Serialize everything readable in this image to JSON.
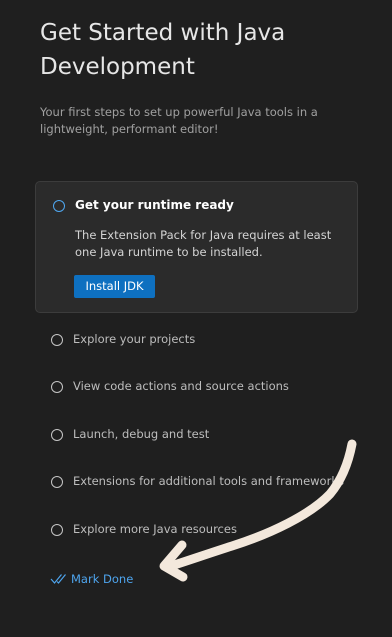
{
  "header": {
    "title": "Get Started with Java Development",
    "description": "Your first steps to set up powerful Java tools in a lightweight, performant editor!"
  },
  "active_step": {
    "title": "Get your runtime ready",
    "description": "The Extension Pack for Java requires at least one Java runtime to be installed.",
    "button_label": "Install JDK"
  },
  "steps": [
    {
      "label": "Explore your projects"
    },
    {
      "label": "View code actions and source actions"
    },
    {
      "label": "Launch, debug and test"
    },
    {
      "label": "Extensions for additional tools and frameworks"
    },
    {
      "label": "Explore more Java resources"
    }
  ],
  "footer": {
    "mark_done_label": "Mark Done",
    "mark_done_icon": "check-all-icon"
  },
  "colors": {
    "background": "#1f1f1f",
    "card": "#2b2b2b",
    "accent": "#0e70c0",
    "link": "#4ea4ed",
    "annotation": "#f3e8dc"
  }
}
